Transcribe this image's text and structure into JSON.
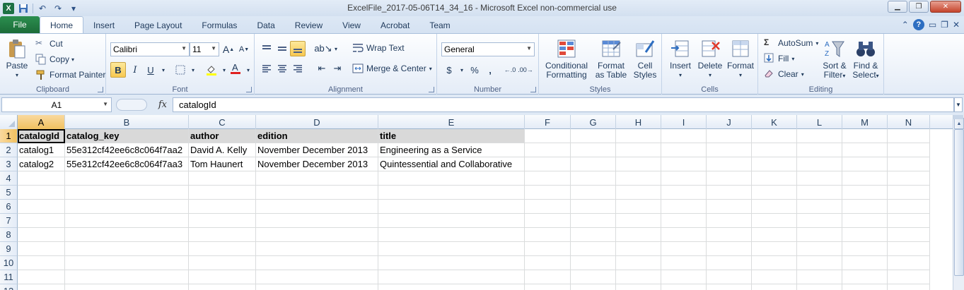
{
  "window": {
    "title": "ExcelFile_2017-05-06T14_34_16  -  Microsoft Excel non-commercial use",
    "logo": "X"
  },
  "tabs": {
    "file": "File",
    "items": [
      "Home",
      "Insert",
      "Page Layout",
      "Formulas",
      "Data",
      "Review",
      "View",
      "Acrobat",
      "Team"
    ],
    "active": "Home"
  },
  "ribbon": {
    "clipboard": {
      "label": "Clipboard",
      "paste": "Paste",
      "cut": "Cut",
      "copy": "Copy",
      "format_painter": "Format Painter"
    },
    "font": {
      "label": "Font",
      "name": "Calibri",
      "size": "11"
    },
    "alignment": {
      "label": "Alignment",
      "wrap_text": "Wrap Text",
      "merge_center": "Merge & Center"
    },
    "number": {
      "label": "Number",
      "format": "General"
    },
    "styles": {
      "label": "Styles",
      "conditional_1": "Conditional",
      "conditional_2": "Formatting",
      "format_table_1": "Format",
      "format_table_2": "as Table",
      "cell_styles_1": "Cell",
      "cell_styles_2": "Styles"
    },
    "cells": {
      "label": "Cells",
      "insert": "Insert",
      "delete": "Delete",
      "format": "Format"
    },
    "editing": {
      "label": "Editing",
      "autosum": "AutoSum",
      "fill": "Fill",
      "clear": "Clear",
      "sort_1": "Sort &",
      "sort_2": "Filter",
      "find_1": "Find &",
      "find_2": "Select"
    }
  },
  "formula_bar": {
    "name_box": "A1",
    "fx": "fx",
    "content": "catalogId"
  },
  "grid": {
    "columns": [
      "A",
      "B",
      "C",
      "D",
      "E",
      "F",
      "G",
      "H",
      "I",
      "J",
      "K",
      "L",
      "M",
      "N"
    ],
    "rows": [
      "1",
      "2",
      "3",
      "4",
      "5",
      "6",
      "7",
      "8",
      "9",
      "10",
      "11",
      "12"
    ],
    "cells": [
      [
        "catalogId",
        "catalog_key",
        "author",
        "edition",
        "title"
      ],
      [
        "catalog1",
        "55e312cf42ee6c8c064f7aa2",
        "David A. Kelly",
        "November December 2013",
        "Engineering as a Service"
      ],
      [
        "catalog2",
        "55e312cf42ee6c8c064f7aa3",
        "Tom Haunert",
        "November December 2013",
        "Quintessential and Collaborative"
      ]
    ]
  }
}
